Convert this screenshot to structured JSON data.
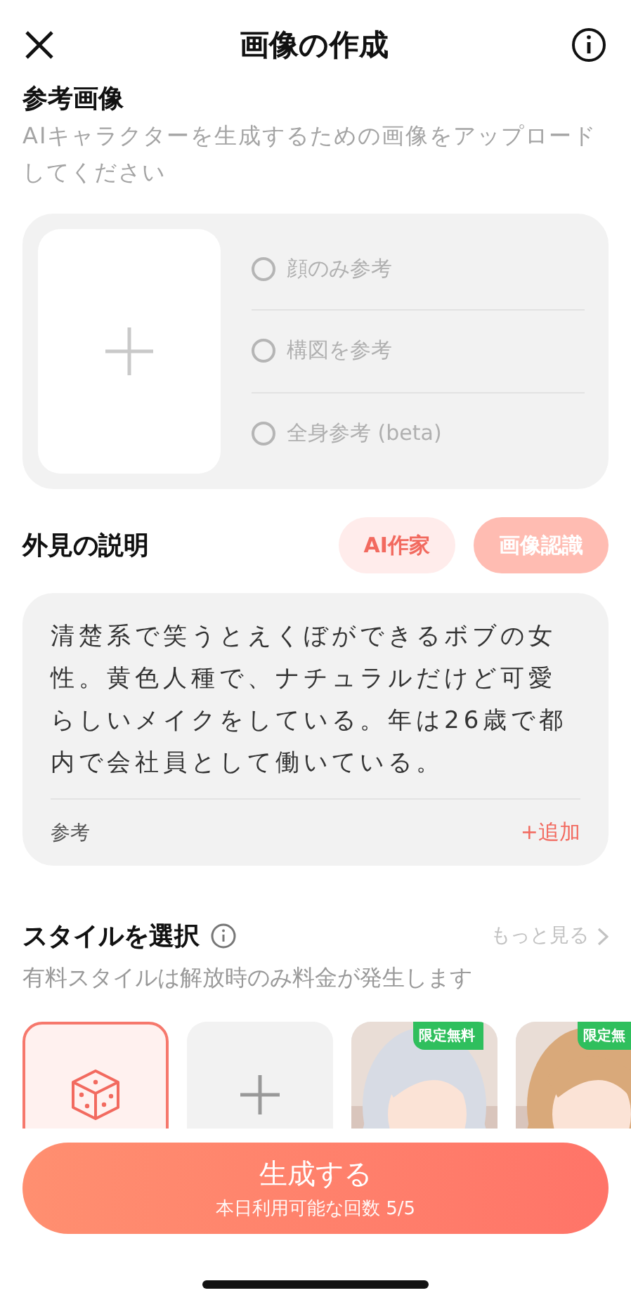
{
  "header": {
    "title": "画像の作成"
  },
  "reference": {
    "title": "参考画像",
    "hint": "AIキャラクターを生成するための画像をアップロードしてください",
    "options": [
      {
        "label": "顔のみ参考",
        "selected": false
      },
      {
        "label": "構図を参考",
        "selected": false
      },
      {
        "label": "全身参考 (beta)",
        "selected": false
      }
    ]
  },
  "appearance": {
    "title": "外見の説明",
    "buttons": [
      {
        "label": "AI作家",
        "kind": "light"
      },
      {
        "label": "画像認識",
        "kind": "filled"
      }
    ],
    "description": "清楚系で笑うとえくぼができるボブの女性。黄色人種で、ナチュラルだけど可愛らしいメイクをしている。年は26歳で都内で会社員として働いている。",
    "footer_label": "参考",
    "add_label": "+追加"
  },
  "styles": {
    "title": "スタイルを選択",
    "more": "もっと見る",
    "note": "有料スタイルは解放時のみ料金が発生します",
    "tiles": [
      {
        "kind": "random",
        "selected": true
      },
      {
        "kind": "add",
        "selected": false
      },
      {
        "kind": "picture",
        "selected": false,
        "badge": "限定無料"
      },
      {
        "kind": "picture",
        "selected": false,
        "badge": "限定無"
      }
    ]
  },
  "generate": {
    "label": "生成する",
    "quota": "本日利用可能な回数 5/5"
  }
}
